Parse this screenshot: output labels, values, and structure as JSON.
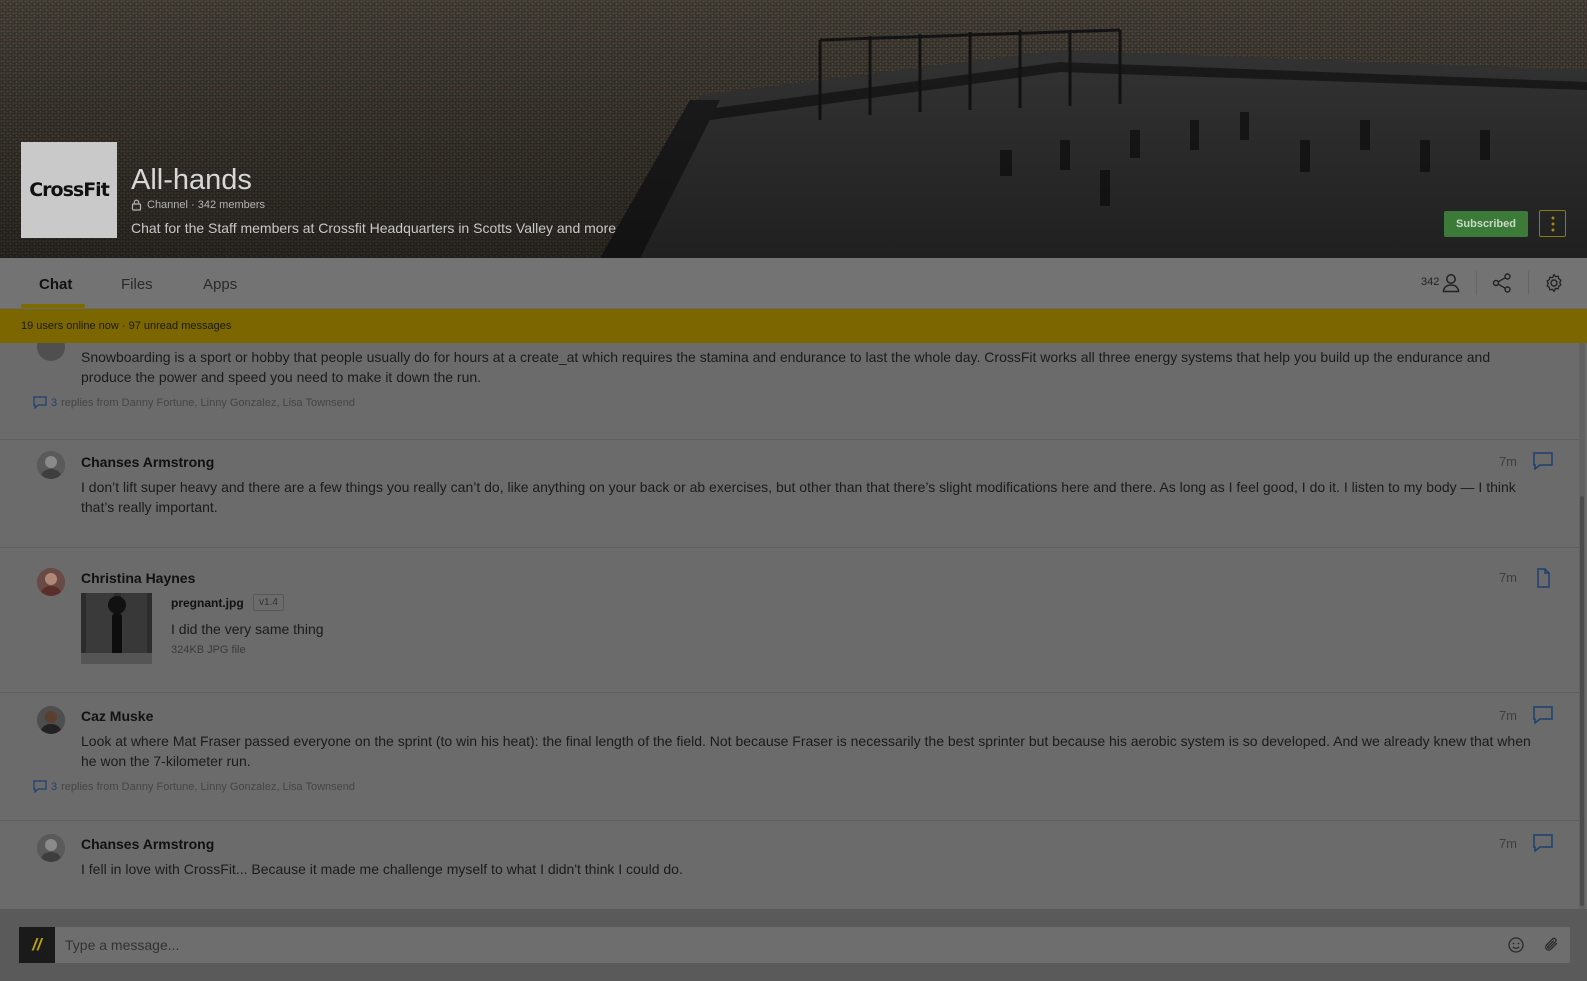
{
  "channel": {
    "logo_text": "CrossFit",
    "title": "All-hands",
    "meta": "Channel · 342 members",
    "description": "Chat for the Staff members at Crossfit Headquarters in Scotts Valley and more",
    "subscribe_label": "Subscribed"
  },
  "tabs": [
    {
      "label": "Chat",
      "active": true
    },
    {
      "label": "Files",
      "active": false
    },
    {
      "label": "Apps",
      "active": false
    }
  ],
  "toolbar": {
    "members_count": "342"
  },
  "banner": {
    "text": "19 users online now · 97 unread messages"
  },
  "messages": [
    {
      "body": "Snowboarding is a sport or hobby that people usually do for hours at a create_at which requires the stamina and endurance to last the whole day. CrossFit works all three energy systems that help you build up the endurance and produce the power and speed you need to make it down the run.",
      "reply_count": "3",
      "reply_text": "replies from Danny Fortune, Linny Gonzalez, Lisa Townsend"
    },
    {
      "author": "Chanses Armstrong",
      "time": "7m",
      "body": "I don’t lift super heavy and there are a few things you really can’t do, like anything on your back or ab exercises, but other than that there’s slight modifications here and there. As long as I feel good, I do it. I listen to my body — I think that’s really important."
    },
    {
      "author": "Christina Haynes",
      "time": "7m",
      "file": {
        "name": "pregnant.jpg",
        "version": "v1.4",
        "caption": "I did the very same thing",
        "meta": "324KB JPG file"
      }
    },
    {
      "author": "Caz Muske",
      "time": "7m",
      "body": "Look at where Mat Fraser passed everyone on the sprint (to win his heat): the final length of the field. Not because Fraser is necessarily the best sprinter but because his aerobic system is so developed. And we already knew that when he won the 7-kilometer run.",
      "reply_count": "3",
      "reply_text": "replies from Danny Fortune, Linny Gonzalez, Lisa Townsend"
    },
    {
      "author": "Chanses Armstrong",
      "time": "7m",
      "body": "I fell in love with CrossFit... Because it made me challenge myself to what I didn't think I could do."
    }
  ],
  "composer": {
    "badge": "//",
    "placeholder": "Type a message..."
  },
  "colors": {
    "accent": "#7d6a00",
    "subscribed": "#3c7a3a",
    "link": "#1f3e72"
  },
  "icons": [
    "lock-icon",
    "more-vertical-icon",
    "members-icon",
    "share-icon",
    "settings-icon",
    "comment-icon",
    "file-icon",
    "emoji-icon",
    "attach-icon"
  ]
}
